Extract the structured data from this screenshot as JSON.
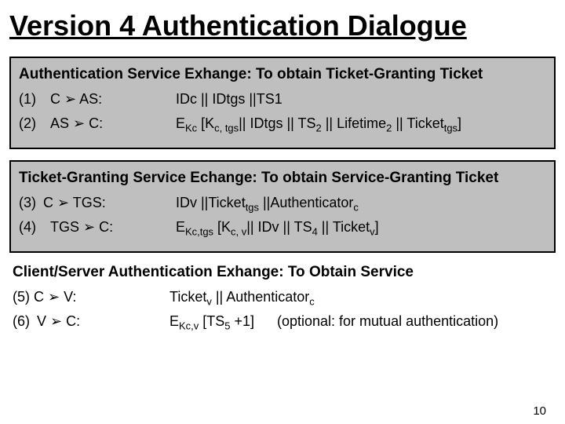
{
  "title": "Version 4 Authentication Dialogue",
  "blocks": {
    "as": {
      "heading": "Authentication Service Exhange: To obtain Ticket-Granting Ticket",
      "row1": {
        "lhs": "(1) C ➢ AS:",
        "rhs": " IDc || IDtgs ||TS1"
      },
      "row2": {
        "lhs": "(2) AS ➢ C:",
        "rhs": "E<sub>Kc</sub> [K<sub>c, tgs</sub>|| IDtgs || TS<sub>2</sub> || Lifetime<sub>2</sub> || Ticket<sub>tgs</sub>]"
      }
    },
    "tgs": {
      "heading": "Ticket-Granting Service Echange: To obtain Service-Granting Ticket",
      "row3": {
        "lhs": "(3) C ➢ TGS:",
        "rhs": "IDv ||Ticket<sub>tgs</sub> ||Authenticator<sub>c</sub>"
      },
      "row4": {
        "lhs": "(4) TGS ➢ C:",
        "rhs": "E<sub>Kc,tgs</sub> [K<sub>c, v</sub>|| IDv || TS<sub>4</sub> || Ticket<sub>v</sub>]"
      }
    },
    "cs": {
      "heading": "Client/Server Authentication Exhange: To Obtain Service",
      "row5": {
        "lhs": "(5) C ➢ V:",
        "rhs": "Ticket<sub>v</sub> || Authenticator<sub>c</sub>"
      },
      "row6": {
        "lhs": "(6) V ➢ C:",
        "rhs": " E<sub>Kc,v</sub> [TS<sub>5</sub> +1]",
        "opt": "(optional: for mutual authentication)"
      }
    }
  },
  "page_number": "10"
}
